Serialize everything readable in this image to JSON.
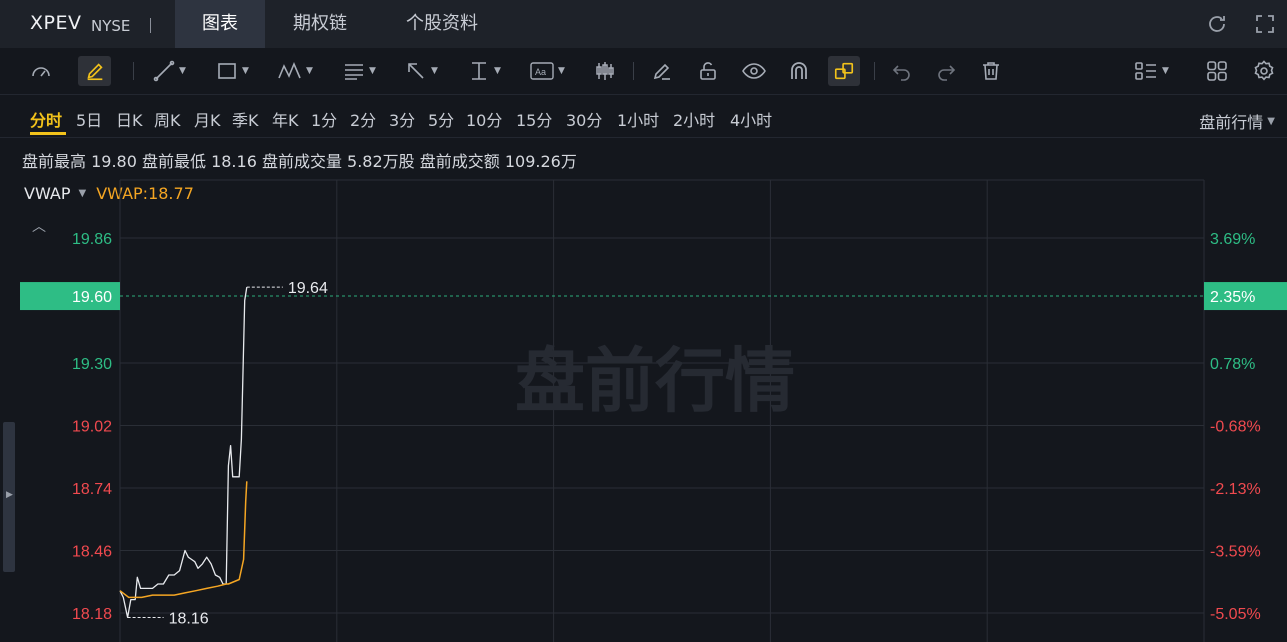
{
  "header": {
    "ticker": "XPEV",
    "exchange": "NYSE",
    "tabs": [
      "图表",
      "期权链",
      "个股资料"
    ],
    "active_tab": 0
  },
  "toolbar": {
    "icons": [
      "gauge-icon",
      "pen-highlight-icon",
      "line-icon",
      "rectangle-icon",
      "wave-icon",
      "fibonacci-icon",
      "arrow-icon",
      "text-cursor-icon",
      "text-box-icon",
      "candle-icon",
      "eraser-icon",
      "unlock-icon",
      "eye-icon",
      "magnet-icon",
      "link-icon",
      "undo-icon",
      "redo-icon",
      "trash-icon",
      "layout-list-icon",
      "grid-icon",
      "settings-icon"
    ]
  },
  "periods": [
    "分时",
    "5日",
    "日K",
    "周K",
    "月K",
    "季K",
    "年K",
    "1分",
    "2分",
    "3分",
    "5分",
    "10分",
    "15分",
    "30分",
    "1小时",
    "2小时",
    "4小时"
  ],
  "active_period": 0,
  "market_select": "盘前行情",
  "stats_line": "盘前最高 19.80 盘前最低 18.16 盘前成交量 5.82万股 盘前成交额 109.26万",
  "indicator": {
    "name": "VWAP",
    "value_label": "VWAP:18.77"
  },
  "colors": {
    "up": "#2ebd85",
    "down": "#f04a4f",
    "price_line": "#e8eaee",
    "vwap_line": "#f5a623",
    "current_badge": "#2ebd85",
    "grid": "#2a2e36",
    "accent": "#f2c21b"
  },
  "chart_data": {
    "type": "line",
    "watermark": "盘前行情",
    "ylim": [
      18.05,
      20.12
    ],
    "xlim": [
      0,
      100
    ],
    "grid": true,
    "y_ticks_left": [
      "19.86",
      "19.30",
      "19.02",
      "18.74",
      "18.46",
      "18.18"
    ],
    "y_ticks_left_values": [
      19.86,
      19.3,
      19.02,
      18.74,
      18.46,
      18.18
    ],
    "y_ticks_right": [
      "3.69%",
      "0.78%",
      "-0.68%",
      "-2.13%",
      "-3.59%",
      "-5.05%"
    ],
    "current_price": "19.60",
    "current_change": "2.35%",
    "high_label": "19.64",
    "low_label": "18.16",
    "high_point": [
      11.7,
      19.64
    ],
    "low_point": [
      0.7,
      18.16
    ],
    "series": [
      {
        "name": "price",
        "x": [
          0,
          0.3,
          0.7,
          1.0,
          1.4,
          1.6,
          1.9,
          2.3,
          2.6,
          3.0,
          3.5,
          4.0,
          4.5,
          5.0,
          5.5,
          6.0,
          6.3,
          6.6,
          6.9,
          7.2,
          7.6,
          8.0,
          8.4,
          8.8,
          9.2,
          9.5,
          9.8,
          10.0,
          10.2,
          10.4,
          10.8,
          11.0,
          11.2,
          11.5,
          11.7
        ],
        "y": [
          18.28,
          18.25,
          18.16,
          18.24,
          18.24,
          18.34,
          18.29,
          18.29,
          18.29,
          18.29,
          18.31,
          18.31,
          18.35,
          18.35,
          18.37,
          18.46,
          18.43,
          18.42,
          18.41,
          18.38,
          18.4,
          18.43,
          18.4,
          18.35,
          18.34,
          18.31,
          18.31,
          18.84,
          18.93,
          18.79,
          18.79,
          18.79,
          18.96,
          19.58,
          19.64
        ]
      },
      {
        "name": "vwap",
        "x": [
          0,
          0.8,
          1.2,
          2.0,
          3.0,
          4.0,
          5.0,
          6.0,
          7.0,
          8.0,
          9.0,
          9.8,
          10.0,
          11.0,
          11.4,
          11.6,
          11.7
        ],
        "y": [
          18.28,
          18.25,
          18.25,
          18.25,
          18.26,
          18.26,
          18.26,
          18.27,
          18.28,
          18.29,
          18.3,
          18.31,
          18.31,
          18.33,
          18.42,
          18.68,
          18.77
        ]
      }
    ]
  }
}
